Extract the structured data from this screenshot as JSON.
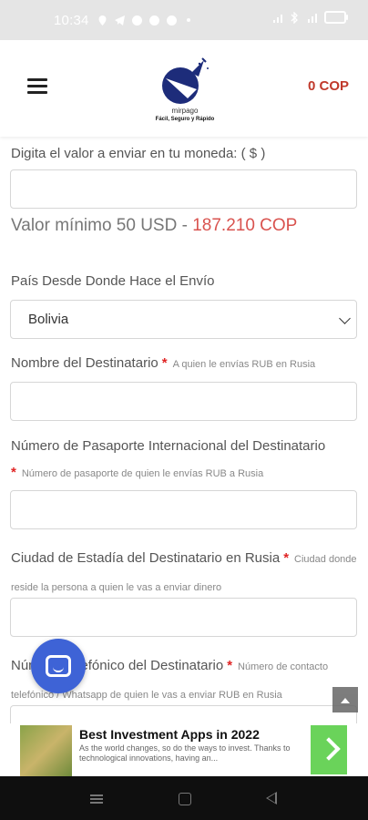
{
  "status_bar": {
    "time": "10:34"
  },
  "header": {
    "logo_name": "mirpago",
    "logo_tagline": "Fácil, Seguro y Rápido",
    "cart_total": "0 COP"
  },
  "form": {
    "amount_label": "Digita el valor a enviar en tu moneda: ( $ )",
    "amount_value": "",
    "min_value_text": "Valor mínimo 50 USD",
    "min_value_separator": " - ",
    "min_value_cop": "187.210 COP",
    "country_label": "País Desde Donde Hace el Envío",
    "country_selected": "Bolivia",
    "recipient_name_label": "Nombre del Destinatario",
    "recipient_name_hint": "A quien le envías RUB en Rusia",
    "passport_label": "Número de Pasaporte Internacional del Destinatario",
    "passport_hint": "Número de pasaporte de quien le envías RUB a Rusia",
    "city_label": "Ciudad de Estadía del Destinatario en Rusia",
    "city_hint": "Ciudad donde reside la persona a quien le vas a enviar dinero",
    "phone_label": "Número Telefónico del Destinatario",
    "phone_hint": "Número de contacto telefónico / Whatsapp de quien le vas a enviar RUB en Rusia",
    "required_mark": "*"
  },
  "ad": {
    "title": "Best Investment Apps in 2022",
    "text": "As the world changes, so do the ways to invest. Thanks to technological innovations, having an..."
  },
  "colors": {
    "accent_red": "#c0392b",
    "chat_blue": "#3e63d6",
    "ad_green": "#6ad35a"
  }
}
